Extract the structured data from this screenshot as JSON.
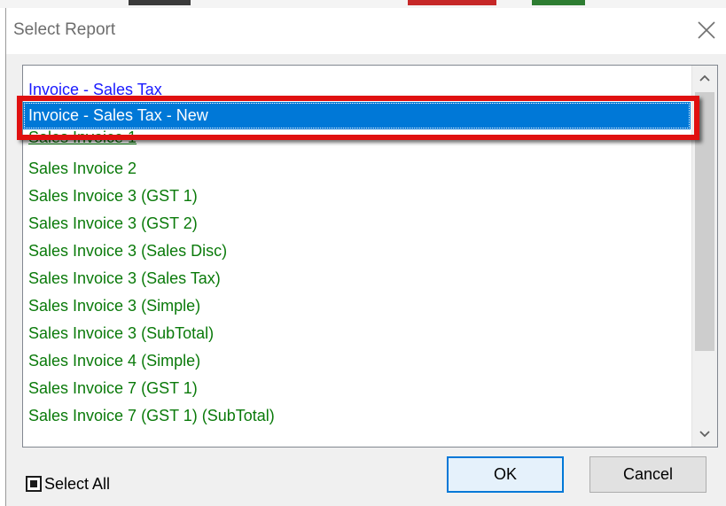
{
  "dialog": {
    "title": "Select Report",
    "close_icon": "close-icon"
  },
  "list": {
    "items": [
      {
        "label": "Invoice - Sales Tax",
        "color": "#1a1aff",
        "state": "normal"
      },
      {
        "label": "Invoice - Sales Tax - New",
        "color": "#ffffff",
        "state": "selected"
      },
      {
        "label": "Sales Invoice 1",
        "color": "#0a7a0a",
        "state": "partially-hidden"
      },
      {
        "label": "Sales Invoice 2",
        "color": "#0a7a0a",
        "state": "normal"
      },
      {
        "label": "Sales Invoice 3 (GST 1)",
        "color": "#0a7a0a",
        "state": "normal"
      },
      {
        "label": "Sales Invoice 3 (GST 2)",
        "color": "#0a7a0a",
        "state": "normal"
      },
      {
        "label": "Sales Invoice 3 (Sales Disc)",
        "color": "#0a7a0a",
        "state": "normal"
      },
      {
        "label": "Sales Invoice 3 (Sales Tax)",
        "color": "#0a7a0a",
        "state": "normal"
      },
      {
        "label": "Sales Invoice 3 (Simple)",
        "color": "#0a7a0a",
        "state": "normal"
      },
      {
        "label": "Sales Invoice 3 (SubTotal)",
        "color": "#0a7a0a",
        "state": "normal"
      },
      {
        "label": "Sales Invoice 4 (Simple)",
        "color": "#0a7a0a",
        "state": "normal"
      },
      {
        "label": "Sales Invoice 7 (GST 1)",
        "color": "#0a7a0a",
        "state": "normal"
      },
      {
        "label": "Sales Invoice 7 (GST 1) (SubTotal)",
        "color": "#0a7a0a",
        "state": "normal"
      }
    ],
    "selected_color": "#0078d7",
    "highlight_color": "#e01010"
  },
  "footer": {
    "select_all_label": "Select All",
    "select_all_state": "indeterminate",
    "ok_label": "OK",
    "cancel_label": "Cancel"
  }
}
